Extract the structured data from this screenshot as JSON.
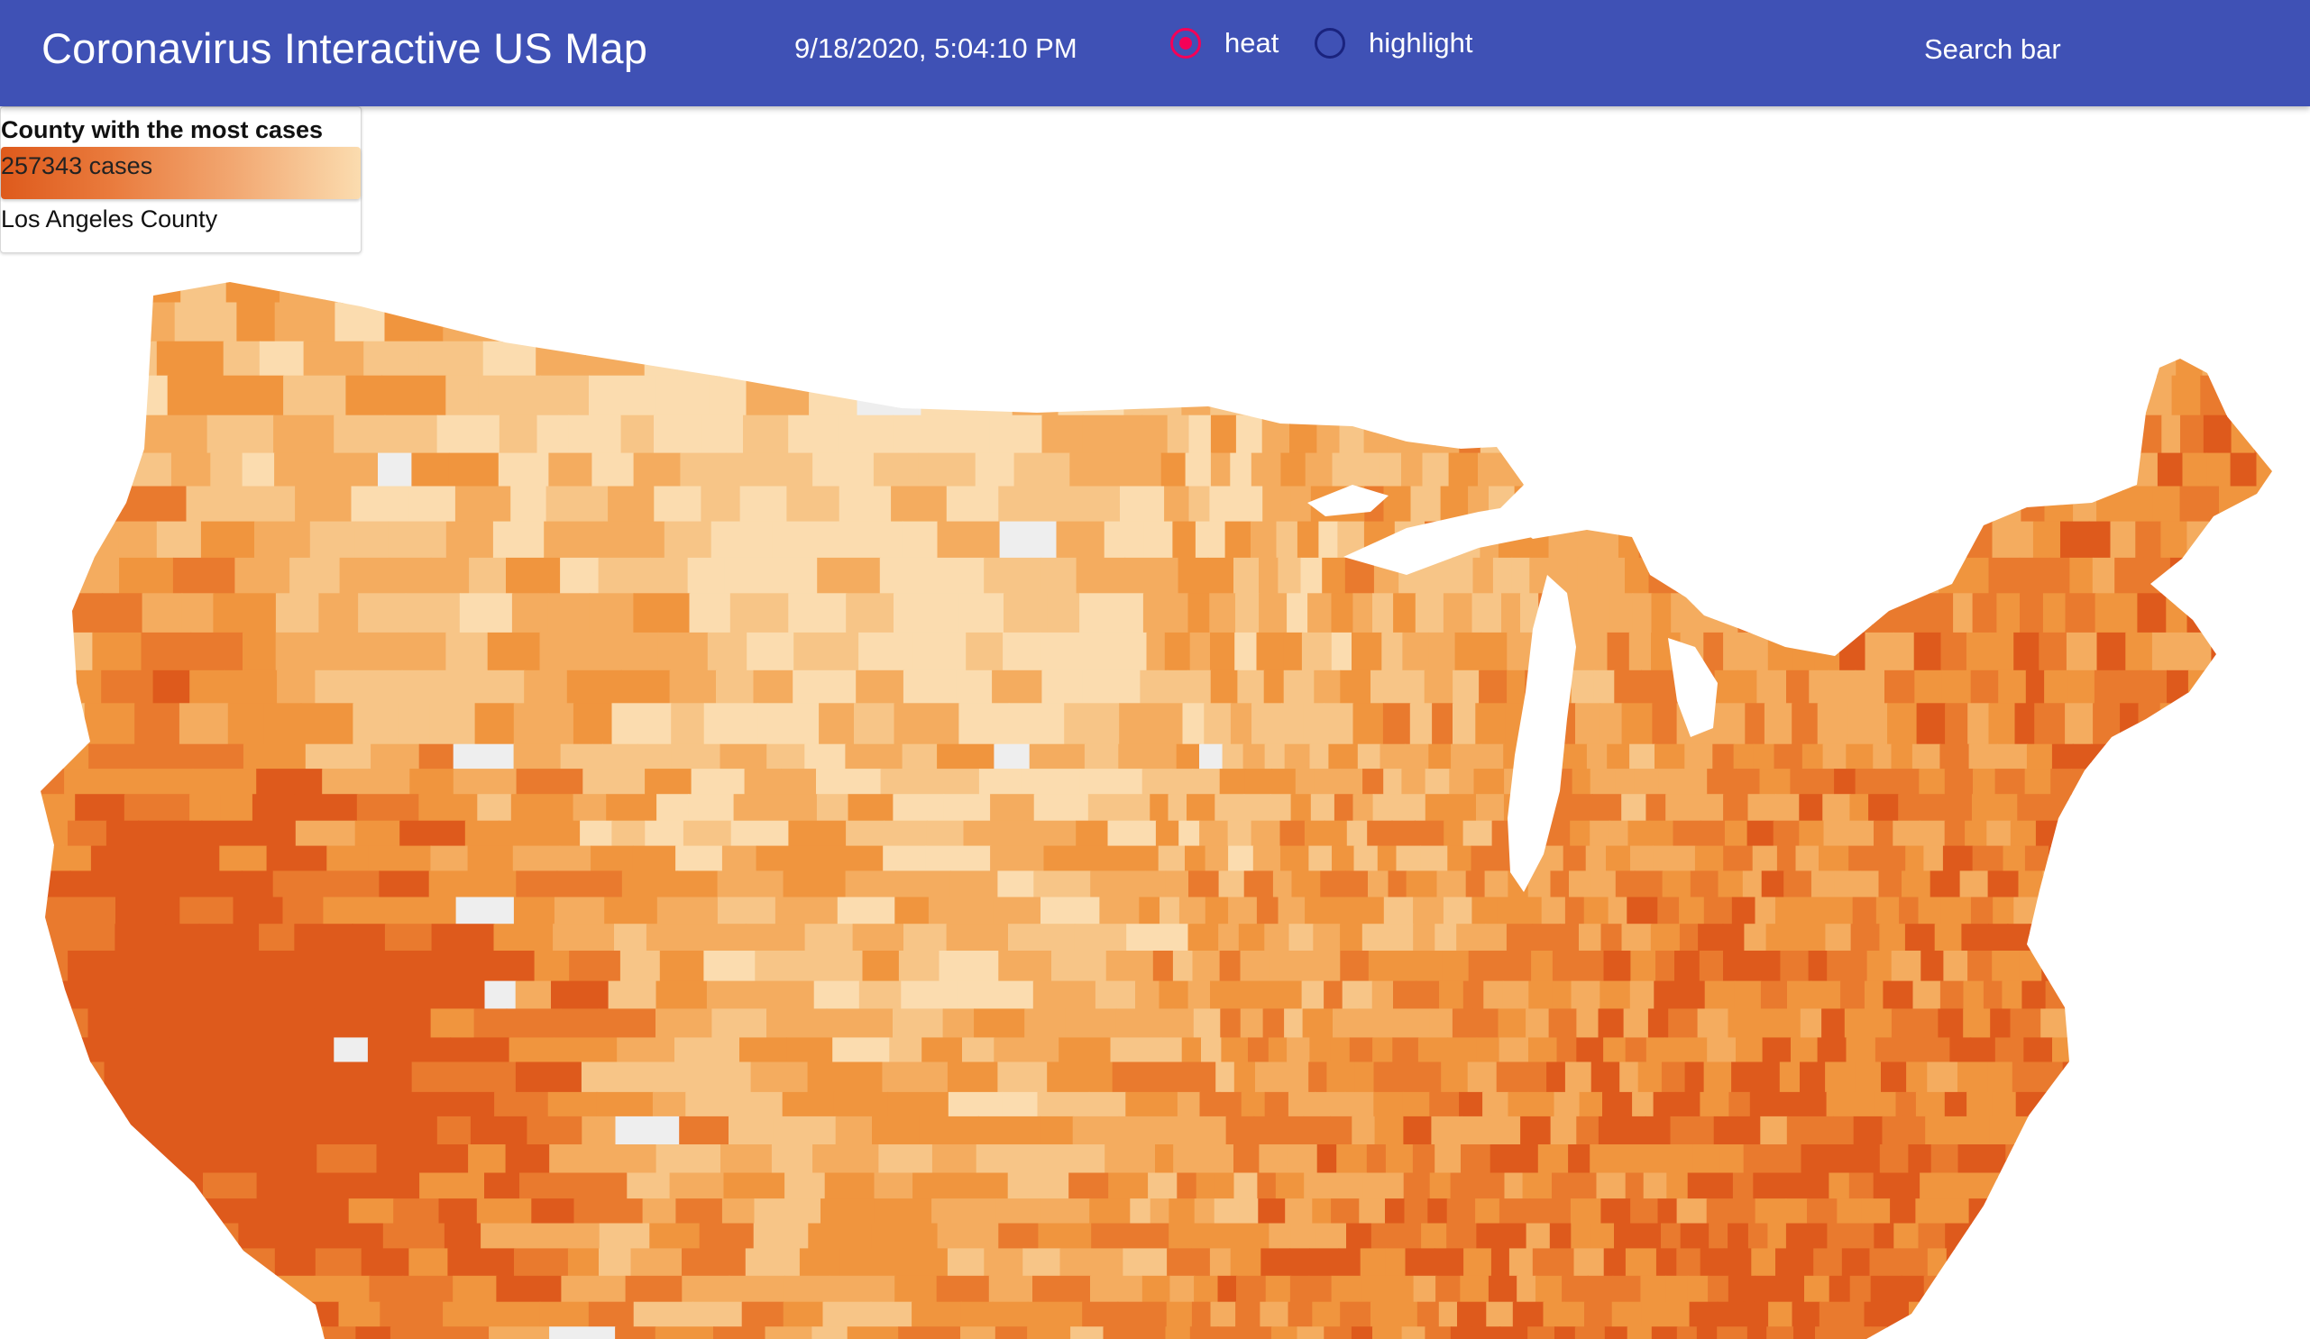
{
  "header": {
    "title": "Coronavirus Interactive US Map",
    "timestamp": "9/18/2020, 5:04:10 PM",
    "modes": [
      {
        "label": "heat",
        "selected": true
      },
      {
        "label": "highlight",
        "selected": false
      }
    ],
    "search_label": "Search bar"
  },
  "legend": {
    "title": "County with the most cases",
    "cases_text": "257343 cases",
    "county_name": "Los Angeles County"
  },
  "colors": {
    "appbar": "#3f51b5",
    "radio_selected": "#f50057",
    "radio_unselected": "#1a237e",
    "heat_scale": [
      "#fbdcaf",
      "#f7c587",
      "#f4ac5f",
      "#f0953e",
      "#e97a2e",
      "#de5a1c"
    ],
    "no_data": "#eeeeee"
  },
  "icons": {
    "radio_selected": "radio-checked-icon",
    "radio_unselected": "radio-unchecked-icon"
  }
}
